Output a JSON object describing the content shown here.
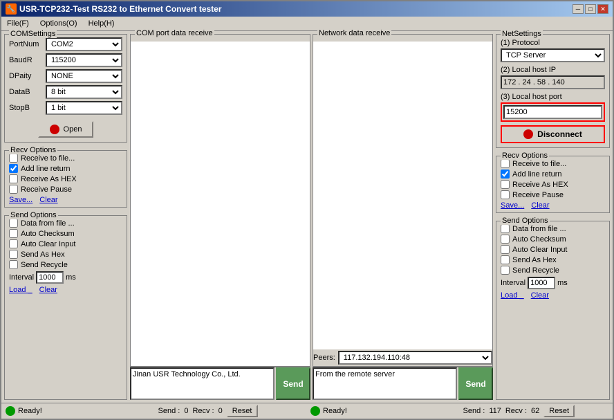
{
  "window": {
    "title": "USR-TCP232-Test  RS232 to Ethernet Convert tester",
    "icon": "🔧"
  },
  "titleButtons": {
    "minimize": "─",
    "maximize": "□",
    "close": "✕"
  },
  "menu": {
    "items": [
      {
        "label": "File(F)"
      },
      {
        "label": "Options(O)"
      },
      {
        "label": "Help(H)"
      }
    ]
  },
  "comSettings": {
    "title": "COMSettings",
    "portNum": {
      "label": "PortNum",
      "value": "COM2"
    },
    "baudRate": {
      "label": "BaudR",
      "value": "115200"
    },
    "dataParity": {
      "label": "DPaity",
      "value": "NONE"
    },
    "dataBits": {
      "label": "DataB",
      "value": "8 bit"
    },
    "stopBits": {
      "label": "StopB",
      "value": "1 bit"
    },
    "openBtn": "Open"
  },
  "comRecvOptions": {
    "title": "Recv Options",
    "options": [
      {
        "label": "Receive to file...",
        "checked": false
      },
      {
        "label": "Add line return",
        "checked": true
      },
      {
        "label": "Receive As HEX",
        "checked": false
      },
      {
        "label": "Receive Pause",
        "checked": false
      }
    ],
    "saveLabel": "Save...",
    "clearLabel": "Clear"
  },
  "comSendOptions": {
    "title": "Send Options",
    "options": [
      {
        "label": "Data from file ...",
        "checked": false
      },
      {
        "label": "Auto Checksum",
        "checked": false
      },
      {
        "label": "Auto Clear Input",
        "checked": false
      },
      {
        "label": "Send As Hex",
        "checked": false
      },
      {
        "label": "Send Recycle",
        "checked": false
      }
    ],
    "intervalLabel": "Interval",
    "intervalValue": "1000",
    "intervalUnit": "ms",
    "loadLabel": "Load _",
    "clearLabel": "Clear"
  },
  "comDataPanel": {
    "title": "COM port data receive",
    "content": ""
  },
  "comSendArea": {
    "text": "Jinan USR Technology Co., Ltd.",
    "sendBtn": "Send"
  },
  "netDataPanel": {
    "title": "Network data receive",
    "content": "",
    "peersLabel": "Peers:",
    "peersValue": "117.132.194.110:48",
    "sendText": "From the remote server",
    "sendBtn": "Send"
  },
  "netSettings": {
    "title": "NetSettings",
    "protocolLabel": "(1) Protocol",
    "protocolValue": "TCP Server",
    "localIpLabel": "(2) Local host IP",
    "localIpValue": "172 . 24 . 58 . 140",
    "localPortLabel": "(3) Local host port",
    "localPortValue": "15200",
    "disconnectBtn": "Disconnect"
  },
  "netRecvOptions": {
    "title": "Recv Options",
    "options": [
      {
        "label": "Receive to file...",
        "checked": false
      },
      {
        "label": "Add line return",
        "checked": true
      },
      {
        "label": "Receive As HEX",
        "checked": false
      },
      {
        "label": "Receive Pause",
        "checked": false
      }
    ],
    "saveLabel": "Save...",
    "clearLabel": "Clear"
  },
  "netSendOptions": {
    "title": "Send Options",
    "options": [
      {
        "label": "Data from file ...",
        "checked": false
      },
      {
        "label": "Auto Checksum",
        "checked": false
      },
      {
        "label": "Auto Clear Input",
        "checked": false
      },
      {
        "label": "Send As Hex",
        "checked": false
      },
      {
        "label": "Send Recycle",
        "checked": false
      }
    ],
    "intervalLabel": "Interval",
    "intervalValue": "1000",
    "intervalUnit": "ms",
    "loadLabel": "Load _",
    "clearLabel": "Clear"
  },
  "statusBar": {
    "leftReady": "Ready!",
    "comSendLabel": "Send :",
    "comSendValue": "0",
    "comRecvLabel": "Recv :",
    "comRecvValue": "0",
    "resetBtn": "Reset",
    "rightReady": "Ready!",
    "netSendLabel": "Send :",
    "netSendValue": "117",
    "netRecvLabel": "Recv :",
    "netRecvValue": "62",
    "resetBtn2": "Reset"
  }
}
